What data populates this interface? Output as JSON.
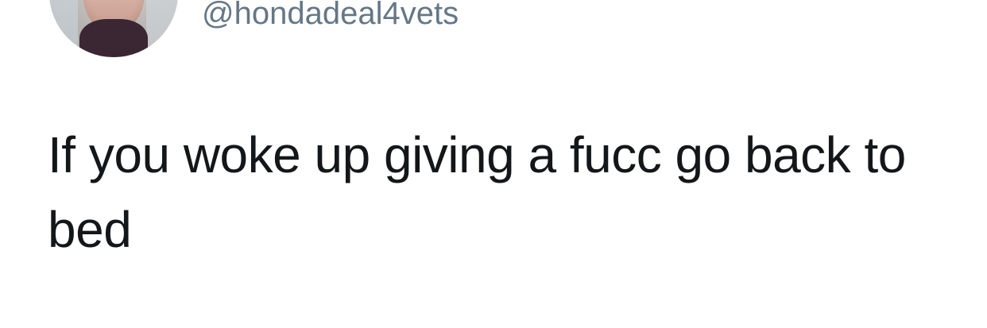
{
  "tweet": {
    "handle": "@hondadeal4vets",
    "text": "If you woke up giving a fucc go back to bed"
  }
}
